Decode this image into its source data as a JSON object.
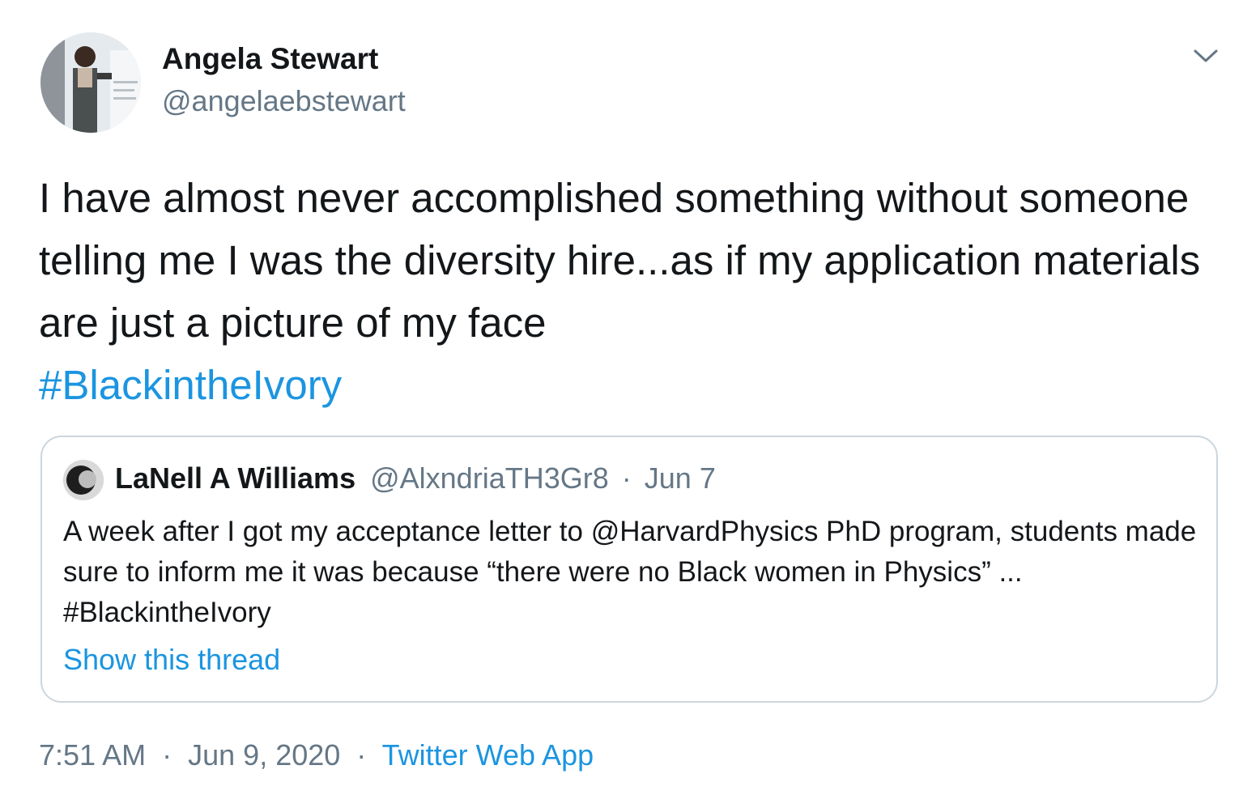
{
  "author": {
    "name": "Angela Stewart",
    "handle": "@angelaebstewart"
  },
  "tweet": {
    "text": "I have almost never accomplished something without someone telling me I was the diversity hire...as if my application materials are just a picture of my face",
    "hashtag": "#BlackintheIvory"
  },
  "quoted_tweet": {
    "name": "LaNell A Williams",
    "handle": "@AlxndriaTH3Gr8",
    "separator": "·",
    "date": "Jun 7",
    "text": "A week after I got my acceptance letter to @HarvardPhysics PhD program, students made sure to inform me it was because “there were no Black women in Physics” ... #BlackintheIvory",
    "show_thread_label": "Show this thread"
  },
  "meta": {
    "time": "7:51 AM",
    "separator": "·",
    "date": "Jun 9, 2020",
    "source": "Twitter Web App"
  },
  "icons": {
    "menu": "chevron-down-icon"
  },
  "colors": {
    "text": "#14171a",
    "secondary": "#657786",
    "link": "#1b95e0",
    "border": "#ccd6dd"
  }
}
